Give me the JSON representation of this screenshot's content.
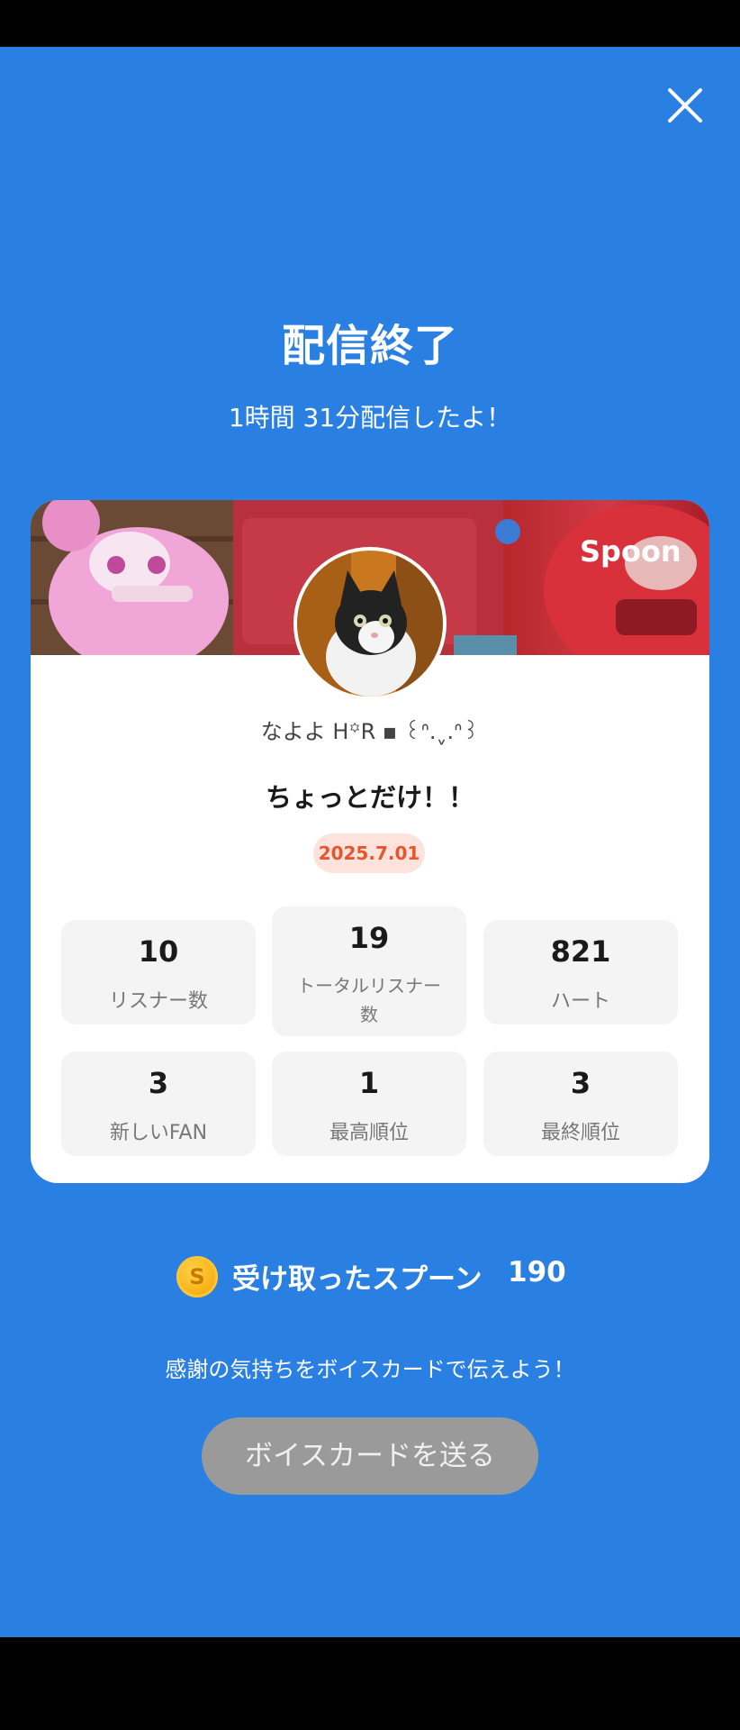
{
  "header": {
    "close_icon": "close-icon"
  },
  "summary": {
    "title": "配信終了",
    "duration_text": "1時間 31分配信したよ！"
  },
  "card": {
    "brand": "Spoon",
    "nickname": "なよよ H꙳R ▪ ꒰ᐢ.ˬ.ᐢ꒱",
    "broadcast_title": "ちょっとだけ！！",
    "date": "2025.7.01",
    "stats": [
      {
        "value": "10",
        "label": "リスナー数"
      },
      {
        "value": "19",
        "label_line1": "トータルリスナー",
        "label_line2": "数"
      },
      {
        "value": "821",
        "label": "ハート"
      },
      {
        "value": "3",
        "label": "新しいFAN"
      },
      {
        "value": "1",
        "label": "最高順位"
      },
      {
        "value": "3",
        "label": "最終順位"
      }
    ]
  },
  "spoons": {
    "coin_symbol": "S",
    "label": "受け取ったスプーン",
    "count": "190"
  },
  "voice_card": {
    "prompt": "感謝の気持ちをボイスカードで伝えよう！",
    "button_label": "ボイスカードを送る"
  },
  "colors": {
    "background": "#2A80E2",
    "card": "#FFFFFF",
    "date_badge_bg": "#FDE3DC",
    "date_badge_text": "#E8542B",
    "button_disabled": "#9A9A9A",
    "coin": "#F7B318"
  }
}
